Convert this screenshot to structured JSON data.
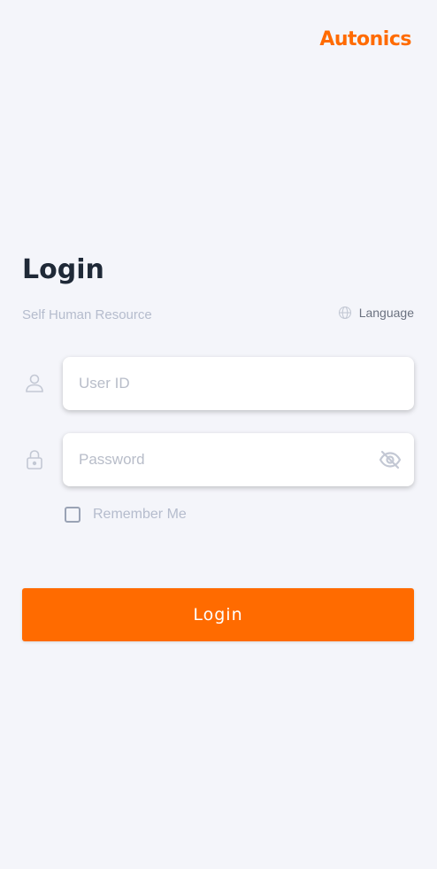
{
  "brand": {
    "logo_text": "Autonics"
  },
  "header": {
    "title": "Login",
    "subtitle": "Self Human Resource",
    "language_label": "Language",
    "language_icon": "globe-icon"
  },
  "form": {
    "user_id": {
      "placeholder": "User ID",
      "value": "",
      "icon": "user-icon"
    },
    "password": {
      "placeholder": "Password",
      "value": "",
      "icon": "lock-icon",
      "toggle_icon": "eye-off-icon"
    },
    "remember_label": "Remember Me",
    "remember_checked": false,
    "submit_label": "Login"
  },
  "colors": {
    "accent": "#ff6b00",
    "background": "#f4f5fa",
    "muted_text": "#b5bccd",
    "title_text": "#1f2937"
  }
}
